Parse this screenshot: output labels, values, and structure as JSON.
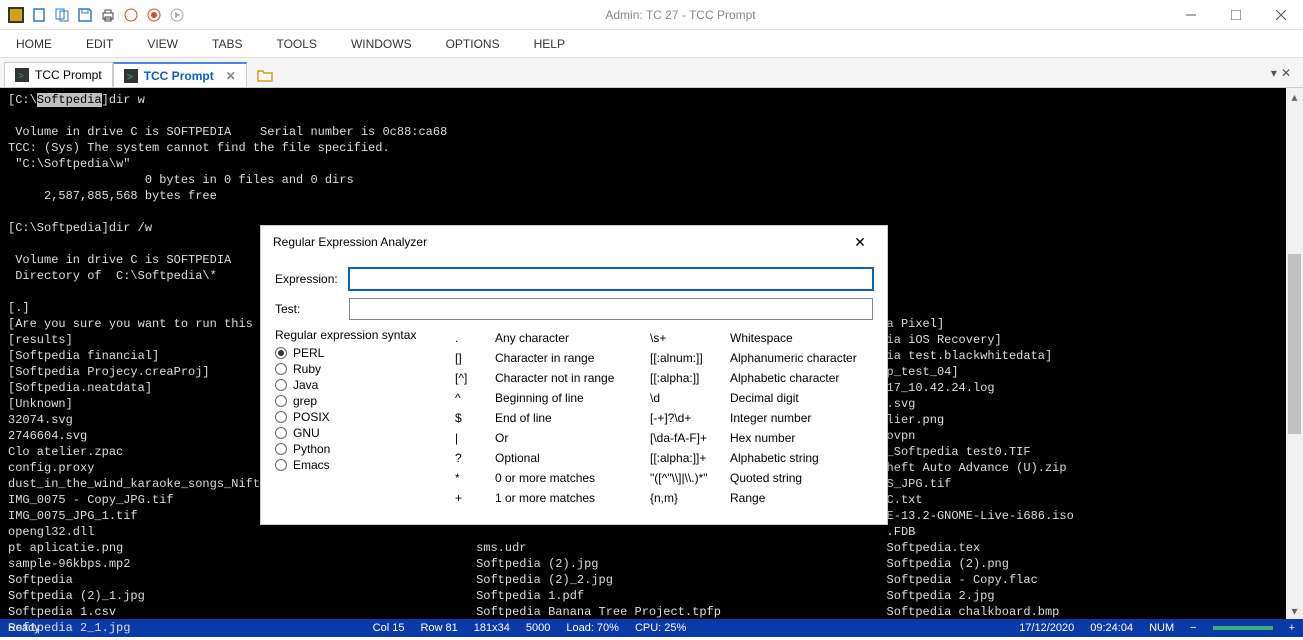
{
  "window": {
    "title": "Admin: TC 27 - TCC Prompt"
  },
  "menu": [
    "HOME",
    "EDIT",
    "VIEW",
    "TABS",
    "TOOLS",
    "WINDOWS",
    "OPTIONS",
    "HELP"
  ],
  "tabs": {
    "items": [
      {
        "label": "TCC Prompt",
        "active": false
      },
      {
        "label": "TCC Prompt",
        "active": true
      }
    ]
  },
  "terminal": {
    "prompt_path": "Softpedia",
    "lines": "[C:\\Softpedia]dir w\n\n Volume in drive C is SOFTPEDIA    Serial number is 0c88:ca68\nTCC: (Sys) The system cannot find the file specified.\n \"C:\\Softpedia\\w\"\n                   0 bytes in 0 files and 0 dirs\n     2,587,885,568 bytes free\n\n[C:\\Softpedia]dir /w\n\n Volume in drive C is SOFTPEDIA\n Directory of  C:\\Softpedia\\*\n\n[.]\n[Are you sure you want to run this t                                                                                     ia Pixel]\n[results]                                                                                                                 ia iOS Recovery]\n[Softpedia financial]                                                                                                     ia test.blackwhitedata]\n[Softpedia Projecy.creaProj]                                                                                              p_test_04]\n[Softpedia.neatdata]                                                                                                      17_10.42.24.log\n[Unknown]                                                                                                                 .svg\n32074.svg                                                                                                                 lier.png\n2746604.svg                                                                                                               ovpn\nClo atelier.zpac                                                                                                          _Softpedia test0.TIF\nconfig.proxy                                                                                                              heft Auto Advance (U).zip\ndust_in_the_wind_karaoke_songs_Nift                                                                                       S_JPG.tif\nIMG_0075 - Copy_JPG.tif                                                                                                   C.txt\nIMG_0075_JPG_1.tif                                                                                                        E-13.2-GNOME-Live-i686.iso\nopengl32.dll                                                                                                              .FDB\npt aplicatie.png                                                            sms.udr                                      Softpedia.tex\nsample-96kbps.mp2                                                           Softpedia (2).jpg                            Softpedia (2).png\nSoftpedia                                                                   Softpedia (2)_2.jpg                          Softpedia - Copy.flac\nSoftpedia (2)_1.jpg                                                         Softpedia 1.pdf                              Softpedia 2.jpg\nSoftpedia 1.csv                                                             Softpedia Banana Tree Project.tpfp           Softpedia chalkboard.bmp\nSoftpedia 2_1.jpg"
  },
  "dialog": {
    "title": "Regular Expression Analyzer",
    "expression_label": "Expression:",
    "test_label": "Test:",
    "expression_value": "",
    "test_value": "",
    "syntax_label": "Regular expression syntax",
    "syntax_options": [
      "PERL",
      "Ruby",
      "Java",
      "grep",
      "POSIX",
      "GNU",
      "Python",
      "Emacs"
    ],
    "syntax_selected": "PERL",
    "reference": {
      "left": [
        {
          "sym": ".",
          "desc": "Any character"
        },
        {
          "sym": "[]",
          "desc": "Character in range"
        },
        {
          "sym": "[^]",
          "desc": "Character not in range"
        },
        {
          "sym": "^",
          "desc": "Beginning of line"
        },
        {
          "sym": "$",
          "desc": "End of line"
        },
        {
          "sym": "|",
          "desc": "Or"
        },
        {
          "sym": "?",
          "desc": "Optional"
        },
        {
          "sym": "*",
          "desc": "0 or more matches"
        },
        {
          "sym": "+",
          "desc": "1 or more matches"
        }
      ],
      "right": [
        {
          "sym": "\\s+",
          "desc": "Whitespace"
        },
        {
          "sym": "[[:alnum:]]",
          "desc": "Alphanumeric character"
        },
        {
          "sym": "[[:alpha:]]",
          "desc": "Alphabetic character"
        },
        {
          "sym": "\\d",
          "desc": "Decimal digit"
        },
        {
          "sym": "[-+]?\\d+",
          "desc": "Integer number"
        },
        {
          "sym": "[\\da-fA-F]+",
          "desc": "Hex number"
        },
        {
          "sym": "[[:alpha:]]+",
          "desc": "Alphabetic string"
        },
        {
          "sym": "\"([^\"\\\\]|\\\\.)*\"",
          "desc": "Quoted string"
        },
        {
          "sym": "{n,m}",
          "desc": "Range"
        }
      ]
    }
  },
  "statusbar": {
    "ready": "Ready",
    "col": "Col 15",
    "row": "Row 81",
    "dim": "181x34",
    "font": "5000",
    "load": "Load: 70%",
    "cpu": "CPU: 25%",
    "date": "17/12/2020",
    "time": "09:24:04",
    "num": "NUM"
  }
}
